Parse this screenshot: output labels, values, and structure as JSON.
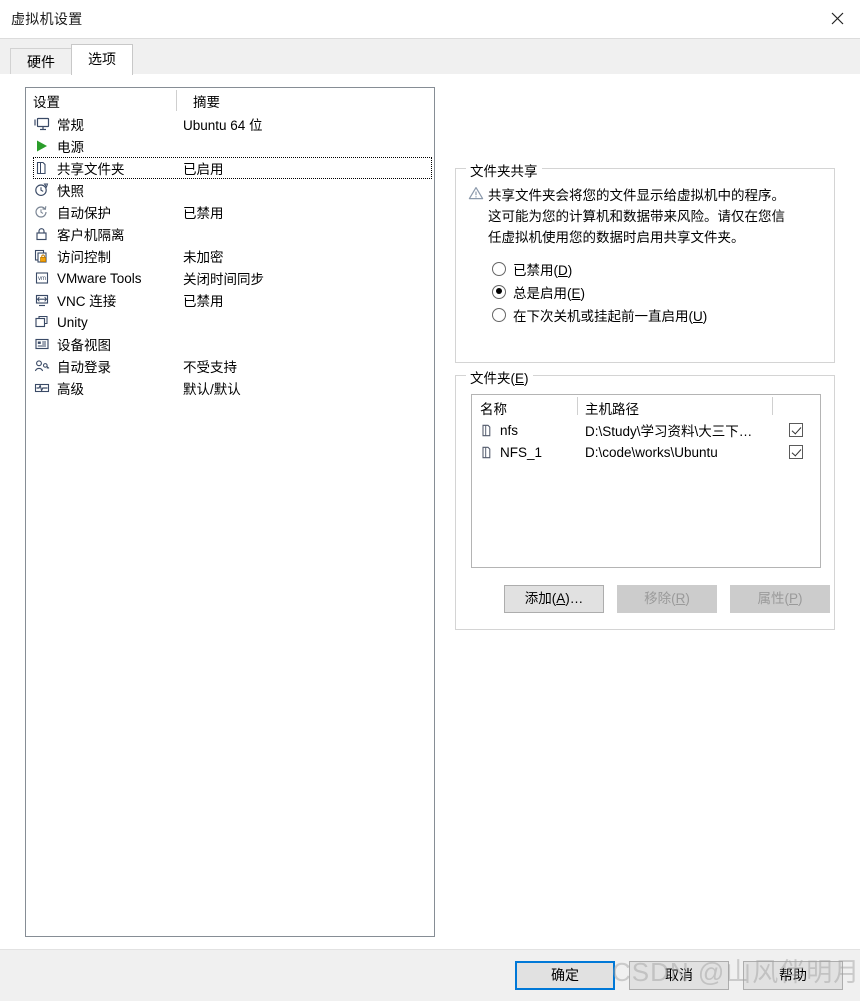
{
  "window": {
    "title": "虚拟机设置",
    "close_icon": "close-icon"
  },
  "tabs": [
    {
      "label": "硬件",
      "active": false
    },
    {
      "label": "选项",
      "active": true
    }
  ],
  "settings_list": {
    "headers": {
      "name": "设置",
      "summary": "摘要"
    },
    "rows": [
      {
        "icon": "monitor-icon",
        "label": "常规",
        "summary": "Ubuntu 64 位",
        "selected": false
      },
      {
        "icon": "power-play-icon",
        "label": "电源",
        "summary": "",
        "selected": false
      },
      {
        "icon": "folder-icon",
        "label": "共享文件夹",
        "summary": "已启用",
        "selected": true
      },
      {
        "icon": "snapshot-icon",
        "label": "快照",
        "summary": "",
        "selected": false
      },
      {
        "icon": "autoprotect-icon",
        "label": "自动保护",
        "summary": "已禁用",
        "selected": false
      },
      {
        "icon": "lock-icon",
        "label": "客户机隔离",
        "summary": "",
        "selected": false
      },
      {
        "icon": "access-control-icon",
        "label": "访问控制",
        "summary": "未加密",
        "selected": false
      },
      {
        "icon": "vmware-tools-icon",
        "label": "VMware Tools",
        "summary": "关闭时间同步",
        "selected": false
      },
      {
        "icon": "vnc-icon",
        "label": "VNC 连接",
        "summary": "已禁用",
        "selected": false
      },
      {
        "icon": "unity-icon",
        "label": "Unity",
        "summary": "",
        "selected": false
      },
      {
        "icon": "device-view-icon",
        "label": "设备视图",
        "summary": "",
        "selected": false
      },
      {
        "icon": "auto-login-icon",
        "label": "自动登录",
        "summary": "不受支持",
        "selected": false
      },
      {
        "icon": "advanced-icon",
        "label": "高级",
        "summary": "默认/默认",
        "selected": false
      }
    ]
  },
  "folder_sharing": {
    "group_label": "文件夹共享",
    "warning_icon": "warning-triangle-icon",
    "warning_text": "共享文件夹会将您的文件显示给虚拟机中的程序。这可能为您的计算机和数据带来风险。请仅在您信任虚拟机使用您的数据时启用共享文件夹。",
    "options": [
      {
        "label": "已禁用(D)",
        "text": "已禁用(",
        "accel": "D",
        "tail": ")",
        "checked": false
      },
      {
        "label": "总是启用(E)",
        "text": "总是启用(",
        "accel": "E",
        "tail": ")",
        "checked": true
      },
      {
        "label": "在下次关机或挂起前一直启用(U)",
        "text": "在下次关机或挂起前一直启用(",
        "accel": "U",
        "tail": ")",
        "checked": false
      }
    ]
  },
  "folders": {
    "group_label_text": "文件夹(",
    "group_label_accel": "E",
    "group_label_tail": ")",
    "headers": {
      "name": "名称",
      "host_path": "主机路径"
    },
    "rows": [
      {
        "icon": "folder-icon",
        "name": "nfs",
        "host_path": "D:\\Study\\学习资料\\大三下…",
        "enabled": true
      },
      {
        "icon": "folder-icon",
        "name": "NFS_1",
        "host_path": "D:\\code\\works\\Ubuntu",
        "enabled": true
      }
    ],
    "buttons": [
      {
        "text": "添加(",
        "accel": "A",
        "tail": ")…",
        "enabled": true
      },
      {
        "text": "移除(",
        "accel": "R",
        "tail": ")",
        "enabled": false
      },
      {
        "text": "属性(",
        "accel": "P",
        "tail": ")",
        "enabled": false
      }
    ]
  },
  "footer": {
    "ok": "确定",
    "cancel": "取消",
    "help": "帮助"
  },
  "watermark": "CSDN @山风伴明月",
  "colors": {
    "accent": "#0078d7",
    "power_green": "#2a9d2a",
    "lock_orange": "#f2a20c",
    "panel_border": "#868d95"
  }
}
